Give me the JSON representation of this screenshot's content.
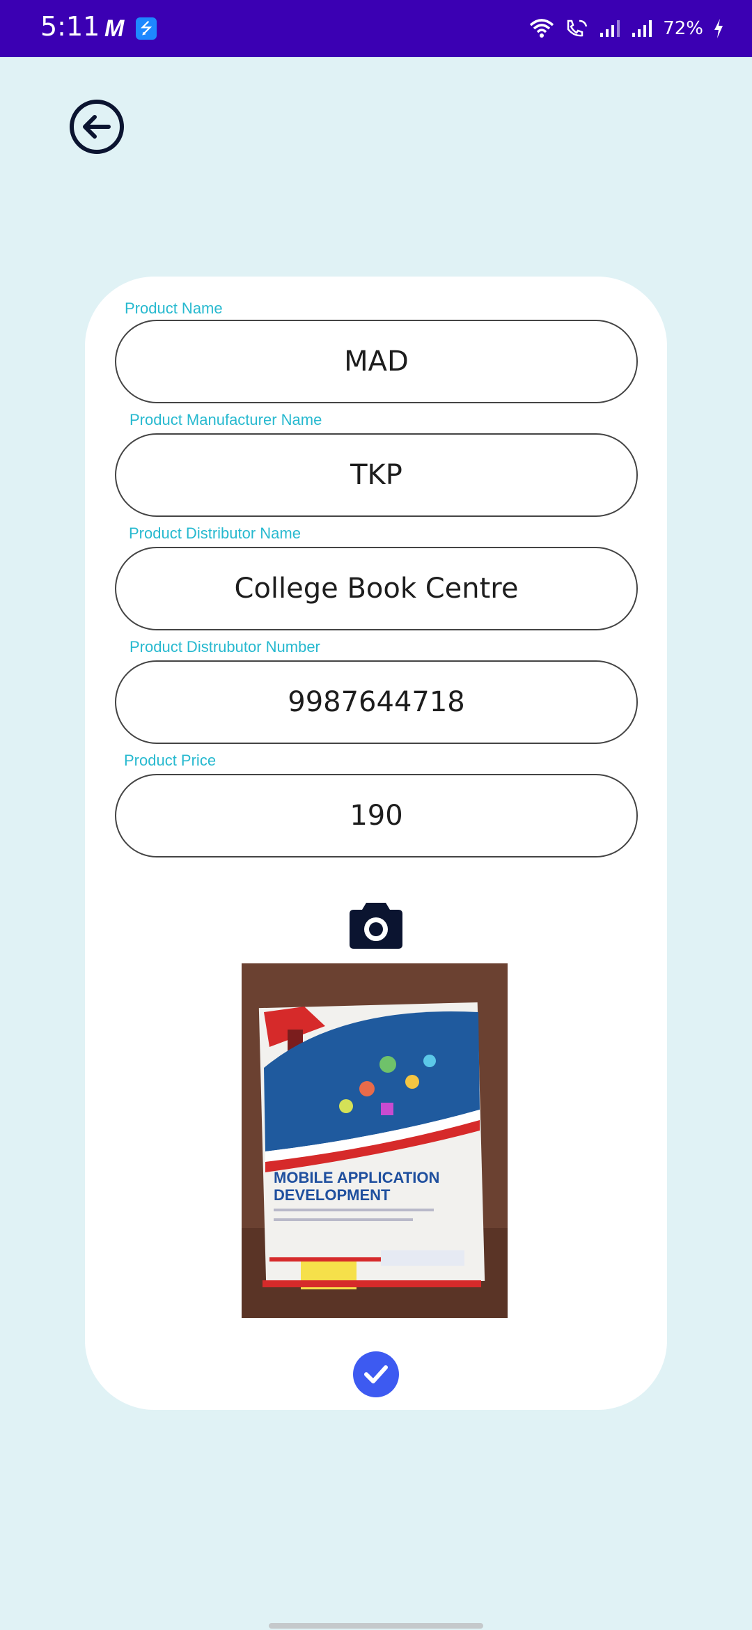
{
  "status_bar": {
    "time": "5:11",
    "carrier_icon": "M",
    "usb_icon": "usb-icon",
    "battery": "72%"
  },
  "form": {
    "fields": [
      {
        "label": "Product Name",
        "value": "MAD"
      },
      {
        "label": "Product Manufacturer Name",
        "value": "TKP"
      },
      {
        "label": "Product Distributor Name",
        "value": "College Book Centre"
      },
      {
        "label": "Product Distrubutor Number",
        "value": "9987644718"
      },
      {
        "label": "Product Price",
        "value": "190"
      }
    ]
  },
  "photo": {
    "title_line1": "MOBILE APPLICATION",
    "title_line2": "DEVELOPMENT"
  },
  "colors": {
    "status_bar": "#3b00b3",
    "background": "#e0f2f5",
    "label": "#27b9cf",
    "confirm": "#3d5af1",
    "icon_dark": "#0b1430"
  }
}
